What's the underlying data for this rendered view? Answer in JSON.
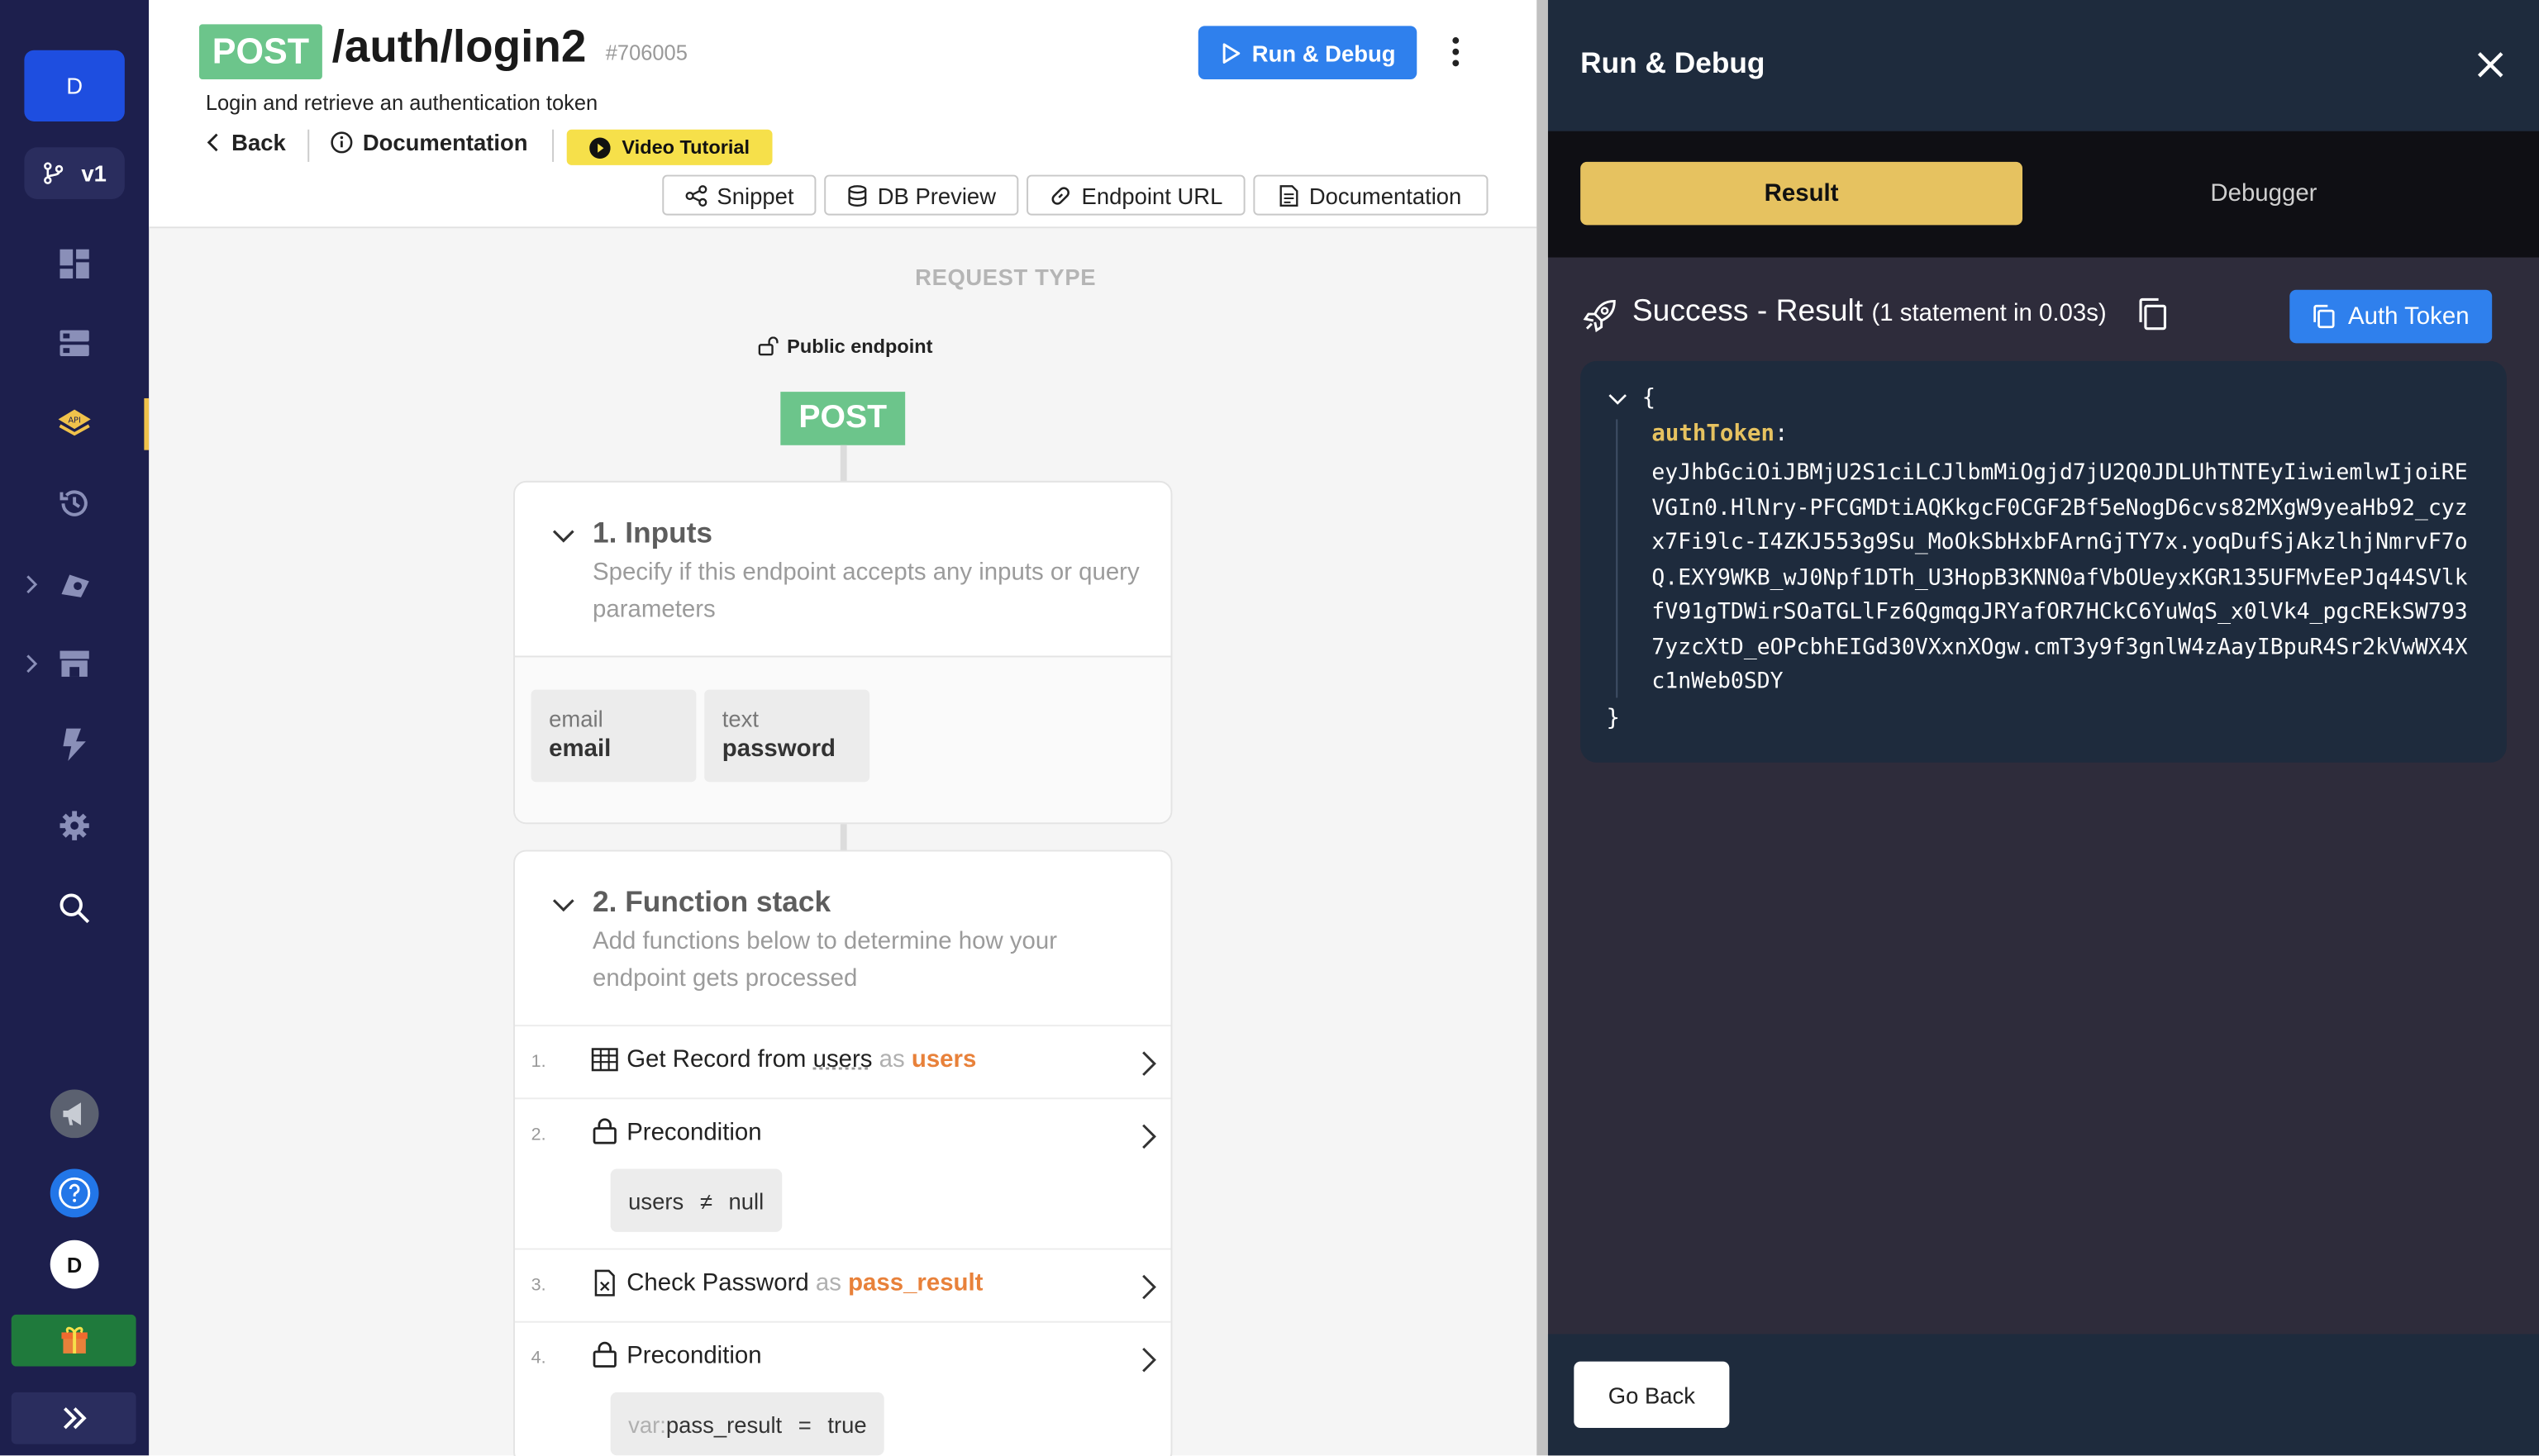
{
  "sidebar": {
    "avatar_initial": "D",
    "version": "v1",
    "user_initial": "D",
    "icons": [
      "dashboard-icon",
      "database-icon",
      "api-icon",
      "history-icon",
      "addons-icon",
      "marketplace-icon",
      "triggers-icon",
      "settings-icon",
      "search-icon",
      "announcements-icon",
      "help-icon",
      "gift-icon",
      "expand-icon"
    ]
  },
  "endpoint": {
    "method": "POST",
    "path": "/auth/login2",
    "id": "#706005",
    "description": "Login and retrieve an authentication token"
  },
  "header": {
    "back_label": "Back",
    "documentation_label": "Documentation",
    "video_label": "Video Tutorial",
    "run_debug_label": "Run & Debug",
    "toolbar": {
      "snippet": "Snippet",
      "db_preview": "DB Preview",
      "endpoint_url": "Endpoint URL",
      "documentation": "Documentation"
    }
  },
  "request": {
    "type_label": "REQUEST TYPE",
    "visibility": "Public endpoint",
    "method": "POST"
  },
  "inputs": {
    "title": "1. Inputs",
    "description": "Specify if this endpoint accepts any inputs or query parameters",
    "fields": [
      {
        "type": "email",
        "name": "email"
      },
      {
        "type": "text",
        "name": "password"
      }
    ]
  },
  "function_stack": {
    "title": "2. Function stack",
    "description": "Add functions below to determine how your endpoint gets processed",
    "steps": [
      {
        "num": "1.",
        "label": "Get Record from",
        "table": "users",
        "as": "as",
        "var": "users"
      },
      {
        "num": "2.",
        "label": "Precondition",
        "left": "users",
        "op": "≠",
        "right": "null"
      },
      {
        "num": "3.",
        "label": "Check Password",
        "as": "as",
        "var": "pass_result"
      },
      {
        "num": "4.",
        "label": "Precondition",
        "prefix": "var:",
        "left": "pass_result",
        "op": "=",
        "right": "true"
      }
    ]
  },
  "panel": {
    "title": "Run & Debug",
    "tab_result": "Result",
    "tab_debugger": "Debugger",
    "status": "Success - Result",
    "status_detail": "(1 statement in 0.03s)",
    "auth_token_button": "Auth Token",
    "result_open": "{",
    "result_close": "}",
    "result_key": "authToken",
    "result_value": "eyJhbGciOiJBMjU2S1ciLCJlbmMiOgjd7jU2Q0JDLUhTNTEyIiwiemlwIjoiREVGIn0.HlNry-PFCGMDtiAQKkgcF0CGF2Bf5eNogD6cvs82MXgW9yeaHb92_cyzx7Fi9lc-I4ZKJ553g9Su_MoOkSbHxbFArnGjTY7x.yoqDufSjAkzlhjNmrvF7oQ.EXY9WKB_wJ0Npf1DTh_U3HopB3KNN0afVbOUeyxKGR135UFMvEePJq44SVlkfV91gTDWirSOaTGLlFz6QgmqgJRYafOR7HCkC6YuWqS_x0lVk4_pgcREkSW7937yzcXtD_eOPcbhEIGd30VXxnXOgw.cmT3y9f3gnlW4zAayIBpuR4Sr2kVwWX4Xc1nWeb0SDY",
    "go_back": "Go Back"
  },
  "colors": {
    "sidebar_bg": "#1d1f4d",
    "post_green": "#6cc58b",
    "run_blue": "#2f80ed",
    "result_gold": "#e6c260",
    "var_orange": "#e8813a",
    "panel_bg": "#2e2c3b"
  }
}
